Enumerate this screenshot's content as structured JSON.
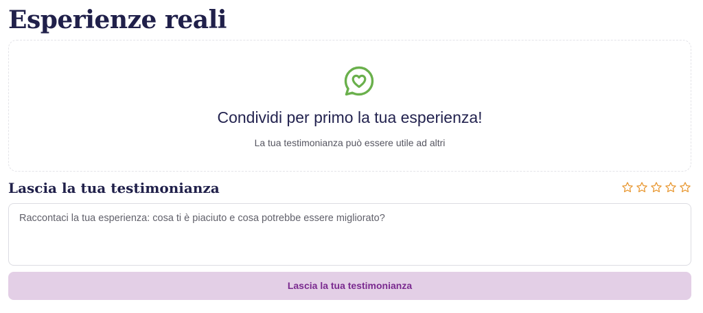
{
  "section": {
    "title": "Esperienze reali"
  },
  "empty_state": {
    "icon": "chat-heart-icon",
    "title": "Condividi per primo la tua esperienza!",
    "subtitle": "La tua testimonianza può essere utile ad altri"
  },
  "form": {
    "title": "Lascia la tua testimonianza",
    "rating": {
      "value": 0,
      "max": 5
    },
    "textarea_placeholder": "Raccontaci la tua esperienza: cosa ti è piaciuto e cosa potrebbe essere migliorato?",
    "textarea_value": "",
    "submit_label": "Lascia la tua testimonianza"
  },
  "colors": {
    "heading": "#20204a",
    "icon_green": "#6ab04c",
    "star_orange": "#e8962e",
    "button_bg": "#e3cfe6",
    "button_text": "#7a2a8f"
  }
}
